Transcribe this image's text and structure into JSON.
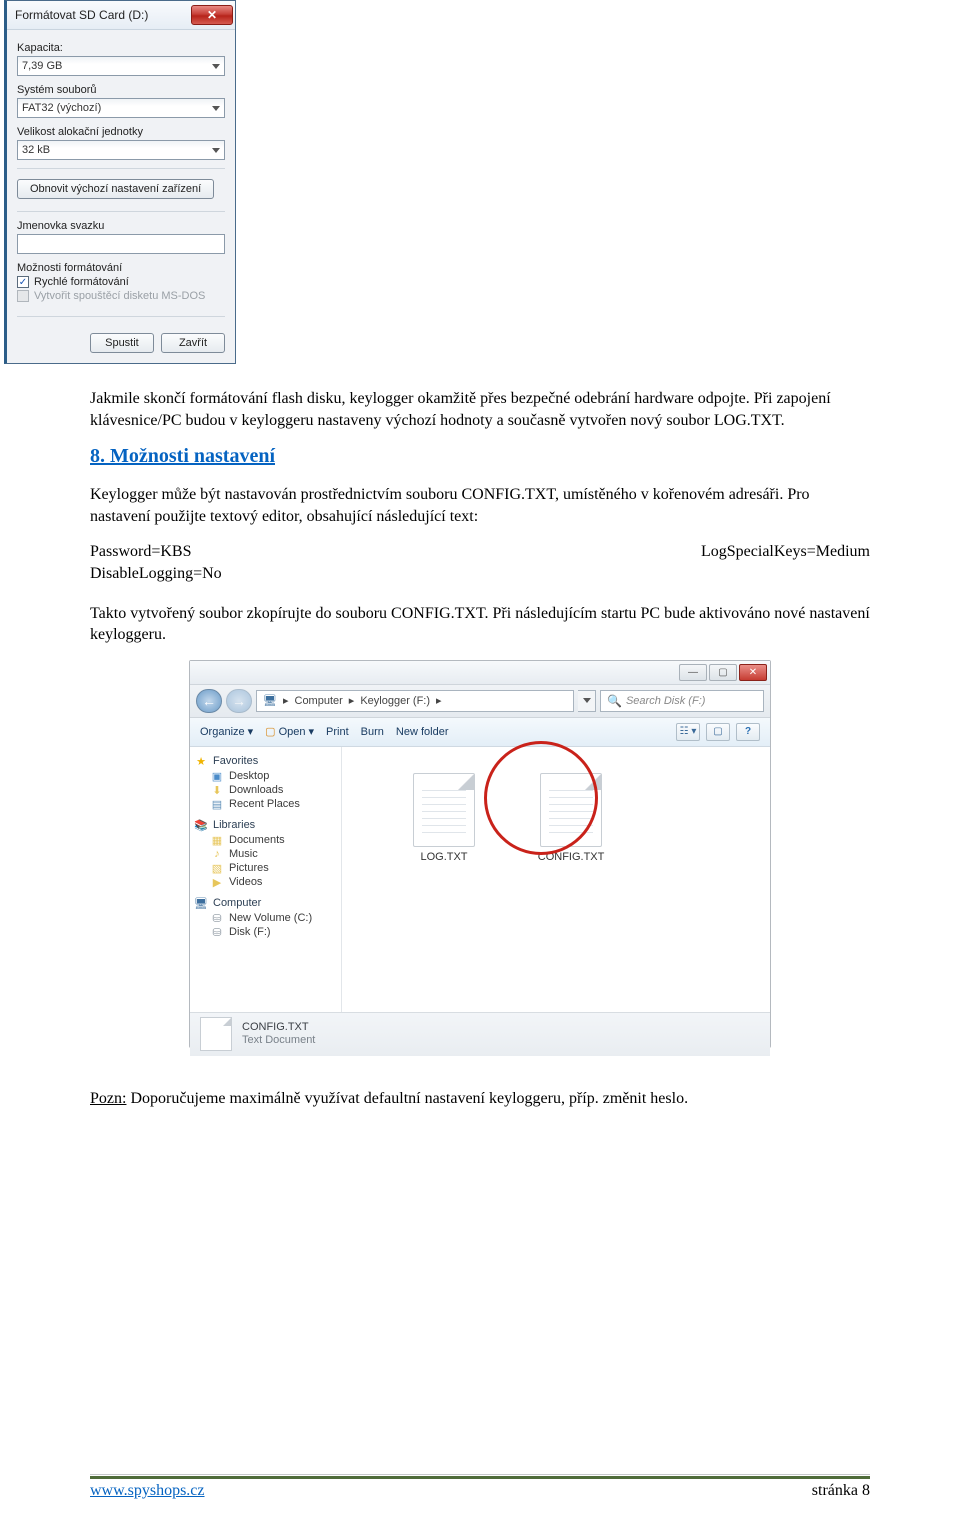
{
  "dialog": {
    "title": "Formátovat SD Card (D:)",
    "labels": {
      "capacity": "Kapacita:",
      "filesystem": "Systém souborů",
      "alloc": "Velikost alokační jednotky",
      "volume": "Jmenovka svazku",
      "options": "Možnosti formátování",
      "quick": "Rychlé formátování",
      "msdos": "Vytvořit spouštěcí disketu MS-DOS",
      "restore": "Obnovit výchozí nastavení zařízení"
    },
    "values": {
      "capacity": "7,39 GB",
      "filesystem": "FAT32 (výchozí)",
      "alloc": "32 kB",
      "volume": ""
    },
    "buttons": {
      "start": "Spustit",
      "close": "Zavřít"
    }
  },
  "body": {
    "para1": "Jakmile skončí formátování flash disku, keylogger okamžitě přes bezpečné odebrání hardware odpojte. Při zapojení klávesnice/PC budou v keyloggeru nastaveny výchozí hodnoty a současně vytvořen nový soubor LOG.TXT.",
    "heading": "8. Možnosti nastavení",
    "para2": "Keylogger může být nastavován prostřednictvím souboru CONFIG.TXT, umístěného v kořenovém adresáři. Pro nastavení použijte textový editor, obsahující následující text:",
    "config": {
      "left1": "Password=KBS",
      "left2": "DisableLogging=No",
      "right1": "LogSpecialKeys=Medium"
    },
    "para3": "Takto vytvořený soubor zkopírujte do souboru CONFIG.TXT. Při následujícím startu PC bude aktivováno nové nastavení keyloggeru.",
    "note_label": "Pozn:",
    "note_text": " Doporučujeme maximálně využívat defaultní nastavení keyloggeru, příp. změnit heslo."
  },
  "explorer": {
    "nav": {
      "path_seg1": "Computer",
      "path_seg2": "Keylogger (F:)"
    },
    "search_placeholder": "Search Disk (F:)",
    "toolbar": {
      "organize": "Organize",
      "open": "Open",
      "print": "Print",
      "burn": "Burn",
      "newfolder": "New folder"
    },
    "sidebar": {
      "favorites": "Favorites",
      "desktop": "Desktop",
      "downloads": "Downloads",
      "recent": "Recent Places",
      "libraries": "Libraries",
      "documents": "Documents",
      "music": "Music",
      "pictures": "Pictures",
      "videos": "Videos",
      "computer": "Computer",
      "volc": "New Volume (C:)",
      "diskf": "Disk (F:)"
    },
    "files": {
      "log": "LOG.TXT",
      "config": "CONFIG.TXT"
    },
    "status": {
      "name": "CONFIG.TXT",
      "type": "Text Document"
    }
  },
  "footer": {
    "url": "www.spyshops.cz",
    "page": "stránka 8"
  }
}
